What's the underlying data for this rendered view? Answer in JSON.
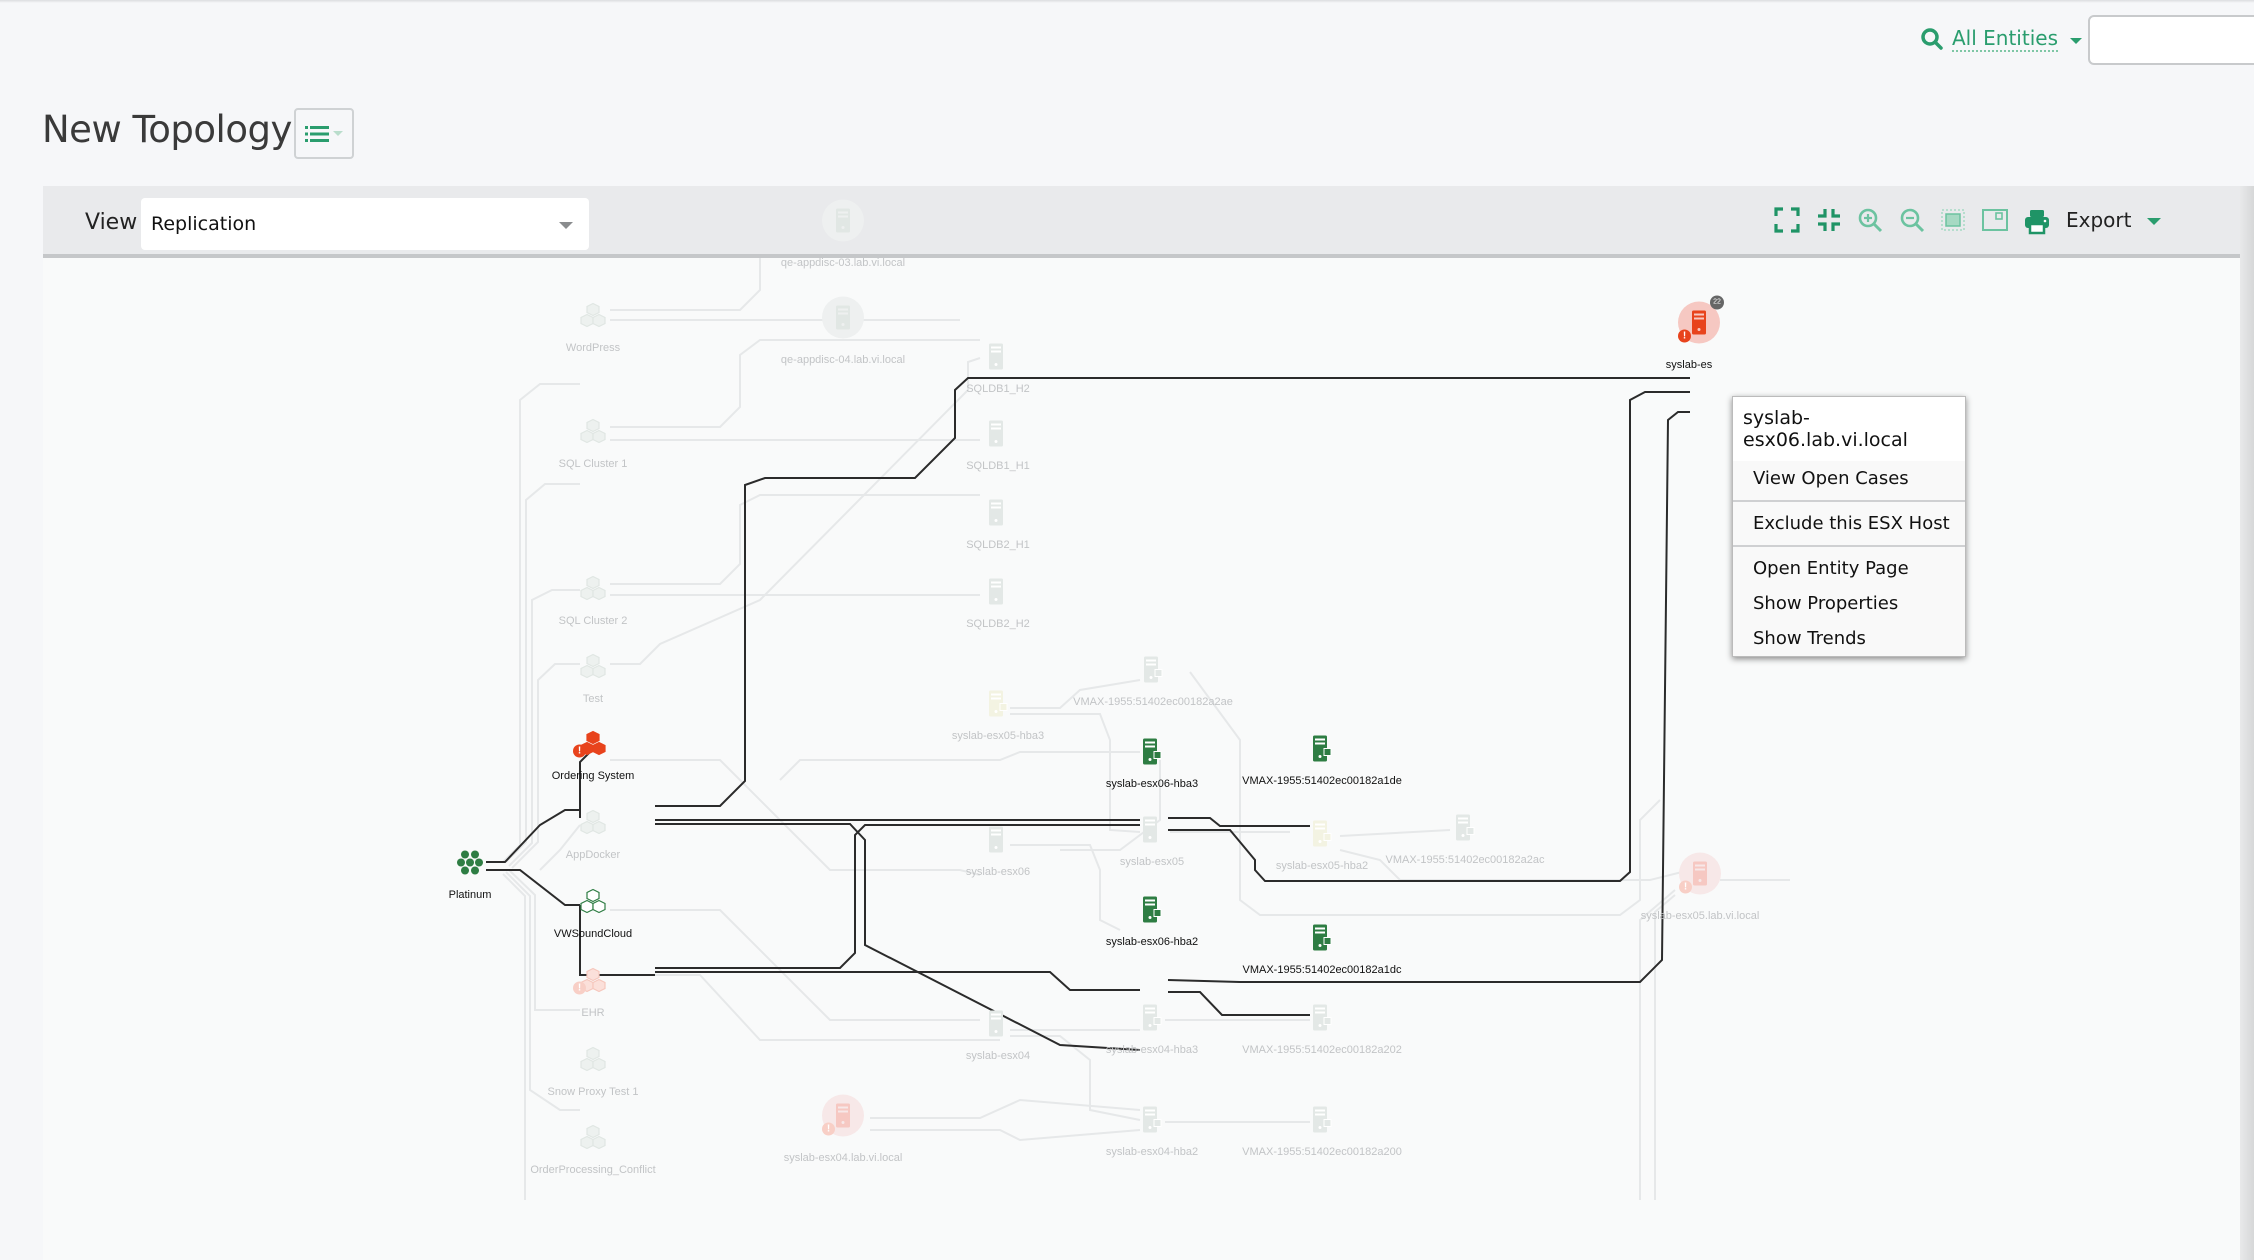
{
  "header": {
    "entity_filter_label": "All Entities",
    "search_value": "",
    "search_placeholder": ""
  },
  "page": {
    "title": "New Topology"
  },
  "toolbar": {
    "view_label": "View",
    "view_selected": "Replication",
    "tools": [
      {
        "name": "expand-icon"
      },
      {
        "name": "collapse-icon"
      },
      {
        "name": "zoom-in-icon"
      },
      {
        "name": "zoom-out-icon"
      },
      {
        "name": "fit-to-screen-icon"
      },
      {
        "name": "overview-icon"
      },
      {
        "name": "print-icon"
      }
    ],
    "export_label": "Export"
  },
  "colors": {
    "accent": "#2a9d6e",
    "active_node": "#2e7d43",
    "alert": "#e8431c",
    "faded_node": "#e3e8e6",
    "faded_label": "#c2c4c6"
  },
  "topology": {
    "nodes": [
      {
        "id": "platinum",
        "label": "Platinum",
        "type": "service-tier",
        "state": "active"
      },
      {
        "id": "ordering",
        "label": "Ordering System",
        "type": "application",
        "state": "alert"
      },
      {
        "id": "vwsound",
        "label": "VWSoundCloud",
        "type": "application",
        "state": "active"
      },
      {
        "id": "wordpress",
        "label": "WordPress",
        "type": "application",
        "state": "faded"
      },
      {
        "id": "sqlc1",
        "label": "SQL Cluster 1",
        "type": "application",
        "state": "faded"
      },
      {
        "id": "sqlc2",
        "label": "SQL Cluster 2",
        "type": "application",
        "state": "faded"
      },
      {
        "id": "test",
        "label": "Test",
        "type": "application",
        "state": "faded"
      },
      {
        "id": "appdocker",
        "label": "AppDocker",
        "type": "application",
        "state": "faded"
      },
      {
        "id": "ehr",
        "label": "EHR",
        "type": "application",
        "state": "faded-alert"
      },
      {
        "id": "snow",
        "label": "Snow Proxy Test 1",
        "type": "application",
        "state": "faded"
      },
      {
        "id": "orderproc",
        "label": "OrderProcessing_Conflict",
        "type": "application",
        "state": "faded"
      },
      {
        "id": "qe03",
        "label": "qe-appdisc-03.lab.vi.local",
        "type": "host",
        "state": "faded"
      },
      {
        "id": "qe04",
        "label": "qe-appdisc-04.lab.vi.local",
        "type": "host",
        "state": "faded"
      },
      {
        "id": "sqldb1h2",
        "label": "SQLDB1_H2",
        "type": "vm",
        "state": "faded"
      },
      {
        "id": "sqldb1h1",
        "label": "SQLDB1_H1",
        "type": "vm",
        "state": "faded"
      },
      {
        "id": "sqldb2h1",
        "label": "SQLDB2_H1",
        "type": "vm",
        "state": "faded"
      },
      {
        "id": "sqldb2h2",
        "label": "SQLDB2_H2",
        "type": "vm",
        "state": "faded"
      },
      {
        "id": "esx05hba3",
        "label": "syslab-esx05-hba3",
        "type": "hba",
        "state": "faded-warn"
      },
      {
        "id": "vmax2ae",
        "label": "VMAX-1955:51402ec00182a2ae",
        "type": "storage",
        "state": "faded"
      },
      {
        "id": "esx06hba3",
        "label": "syslab-esx06-hba3",
        "type": "hba",
        "state": "active"
      },
      {
        "id": "vmax1de",
        "label": "VMAX-1955:51402ec00182a1de",
        "type": "storage",
        "state": "active"
      },
      {
        "id": "esx06",
        "label": "syslab-esx06",
        "type": "vm",
        "state": "faded"
      },
      {
        "id": "esx05",
        "label": "syslab-esx05",
        "type": "vm",
        "state": "faded"
      },
      {
        "id": "esx05hba2",
        "label": "syslab-esx05-hba2",
        "type": "hba",
        "state": "faded-warn"
      },
      {
        "id": "vmax2ac",
        "label": "VMAX-1955:51402ec00182a2ac",
        "type": "storage",
        "state": "faded"
      },
      {
        "id": "esx06hba2",
        "label": "syslab-esx06-hba2",
        "type": "hba",
        "state": "active"
      },
      {
        "id": "vmax1dc",
        "label": "VMAX-1955:51402ec00182a1dc",
        "type": "storage",
        "state": "active"
      },
      {
        "id": "esx04",
        "label": "syslab-esx04",
        "type": "vm",
        "state": "faded"
      },
      {
        "id": "esx04hba3",
        "label": "syslab-esx04-hba3",
        "type": "hba",
        "state": "faded"
      },
      {
        "id": "vmax202",
        "label": "VMAX-1955:51402ec00182a202",
        "type": "storage",
        "state": "faded"
      },
      {
        "id": "esx04hba2",
        "label": "syslab-esx04-hba2",
        "type": "hba",
        "state": "faded"
      },
      {
        "id": "vmax200",
        "label": "VMAX-1955:51402ec00182a200",
        "type": "storage",
        "state": "faded"
      },
      {
        "id": "esx05host",
        "label": "syslab-esx05.lab.vi.local",
        "type": "esx-host",
        "state": "faded-alert"
      },
      {
        "id": "esx04host",
        "label": "syslab-esx04.lab.vi.local",
        "type": "esx-host",
        "state": "faded-alert"
      },
      {
        "id": "esx06host",
        "label": "syslab-es",
        "type": "esx-host",
        "state": "selected-alert",
        "badge": "22"
      }
    ]
  },
  "context_menu": {
    "title": "syslab-esx06.lab.vi.local",
    "groups": [
      [
        "View Open Cases"
      ],
      [
        "Exclude this ESX Host"
      ],
      [
        "Open Entity Page",
        "Show Properties",
        "Show Trends"
      ]
    ]
  }
}
